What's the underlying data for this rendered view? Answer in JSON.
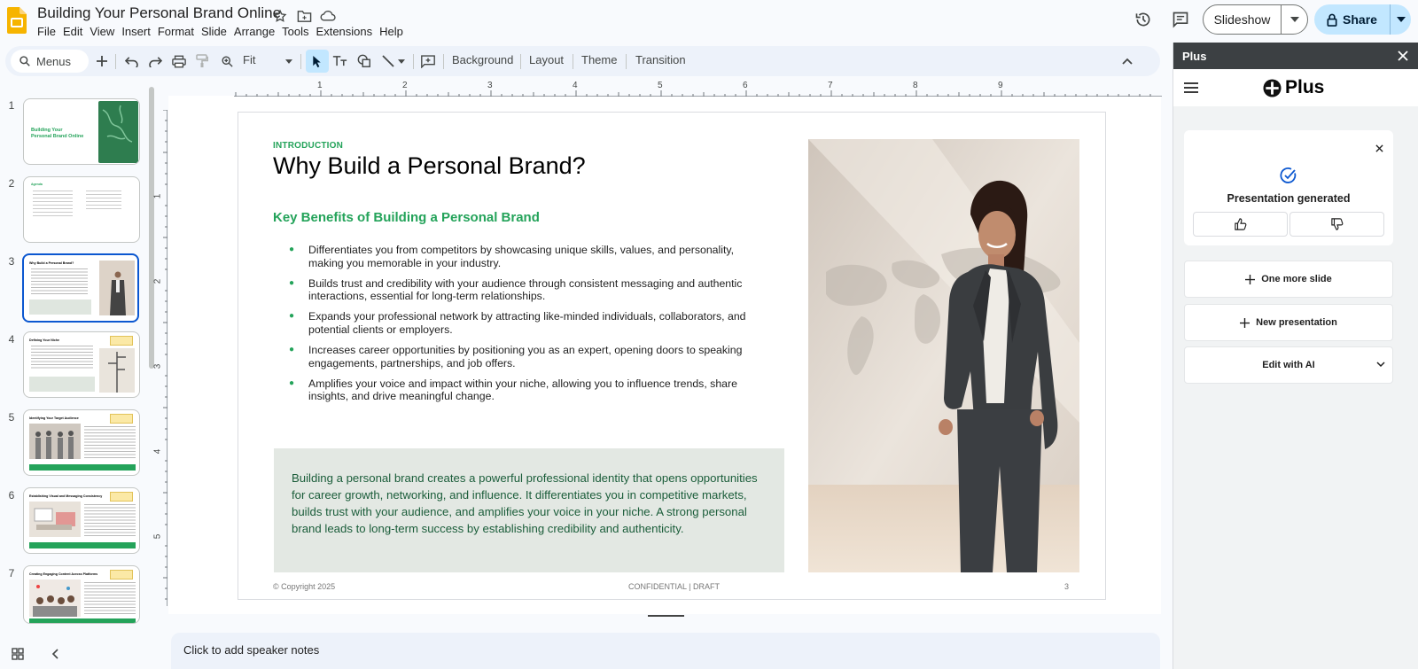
{
  "app": {
    "doc_title": "Building Your Personal Brand Online",
    "menu": [
      "File",
      "Edit",
      "View",
      "Insert",
      "Format",
      "Slide",
      "Arrange",
      "Tools",
      "Extensions",
      "Help"
    ],
    "slideshow_label": "Slideshow",
    "share_label": "Share"
  },
  "toolbar": {
    "menus_placeholder": "Menus",
    "zoom": "Fit",
    "background_label": "Background",
    "layout_label": "Layout",
    "theme_label": "Theme",
    "transition_label": "Transition"
  },
  "filmstrip": {
    "selected": 3,
    "slides": [
      {
        "num": "1",
        "title": "Building Your Personal Brand Online"
      },
      {
        "num": "2",
        "title": "Agenda"
      },
      {
        "num": "3",
        "title": "Why Build a Personal Brand?"
      },
      {
        "num": "4",
        "title": "Defining Your Niche"
      },
      {
        "num": "5",
        "title": "Identifying Your Target Audience"
      },
      {
        "num": "6",
        "title": "Establishing Visual and Messaging Consistency"
      },
      {
        "num": "7",
        "title": "Creating Engaging Content Across Platforms"
      }
    ]
  },
  "rulers": {
    "h_ticks": [
      "1",
      "2",
      "3",
      "4",
      "5",
      "6",
      "7",
      "8",
      "9"
    ],
    "v_ticks": [
      "1",
      "2",
      "3",
      "4",
      "5"
    ]
  },
  "slide": {
    "label": "INTRODUCTION",
    "title": "Why Build a Personal Brand?",
    "subheading": "Key Benefits of Building a Personal Brand",
    "bullets": [
      "Differentiates  you from competitors  by showcasing unique skills, values, and personality, making you memorable in your industry.",
      "Builds trust and credibility with your audience through consistent messaging and authentic interactions, essential for long-term relationships.",
      "Expands your professional network by attracting like-minded individuals, collaborators, and potential clients or employers.",
      "Increases career opportunities by positioning you as an expert, opening doors to speaking engagements, partnerships, and job offers.",
      "Amplifies your voice and impact within your niche, allowing you to influence trends, share insights, and drive meaningful change."
    ],
    "summary": "Building a personal brand creates a powerful professional  identity  that opens opportunities  for career growth, networking,  and influence. It differentiates  you in competitive  markets, builds trust with your audience, and amplifies your voice in your niche. A strong personal brand leads to long-term success by establishing credibility and authenticity.",
    "footer_copyright": "© Copyright  2025",
    "footer_confidential": "CONFIDENTIAL  | DRAFT",
    "footer_page": "3",
    "accent_color": "#24a35a"
  },
  "notes_placeholder": "Click to add speaker notes",
  "panel": {
    "header": "Plus",
    "brand": "Plus",
    "generated_text": "Presentation generated",
    "one_more_slide": "One more slide",
    "new_presentation": "New presentation",
    "edit_with_ai": "Edit with AI"
  }
}
